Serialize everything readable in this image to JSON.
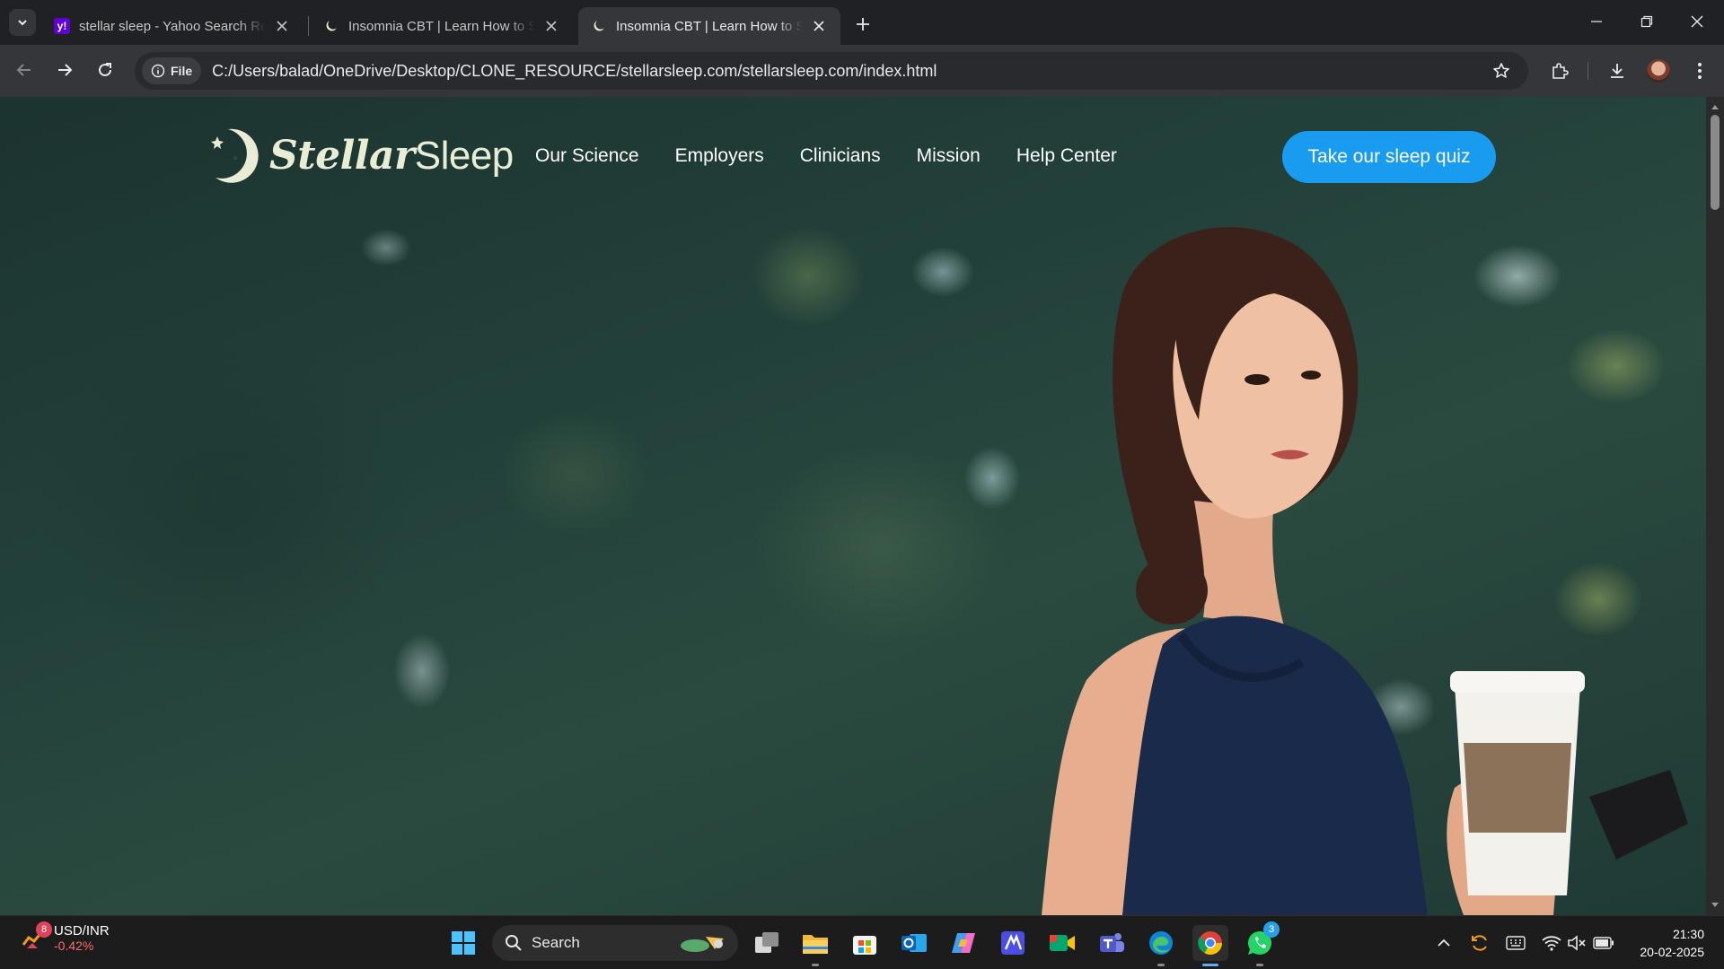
{
  "browser": {
    "tabs": [
      {
        "title": "stellar sleep - Yahoo Search Res",
        "favicon": "yahoo-icon",
        "active": false
      },
      {
        "title": "Insomnia CBT | Learn How to Sleep",
        "favicon": "moon-icon",
        "active": false
      },
      {
        "title": "Insomnia CBT | Learn How to Sleep",
        "favicon": "moon-icon",
        "active": true
      }
    ],
    "address": {
      "scheme_label": "File",
      "url": "C:/Users/balad/OneDrive/Desktop/CLONE_RESOURCE/stellarsleep.com/stellarsleep.com/index.html"
    }
  },
  "site": {
    "logo": {
      "part1": "Stellar",
      "part2": "Sleep"
    },
    "nav": [
      "Our Science",
      "Employers",
      "Clinicians",
      "Mission",
      "Help Center"
    ],
    "cta": "Take our sleep quiz",
    "colors": {
      "cta": "#199cf0",
      "logo": "#e9edd6"
    }
  },
  "taskbar": {
    "widget": {
      "badge": "8",
      "label": "USD/INR",
      "change": "-0.42%"
    },
    "search_label": "Search",
    "whatsapp_badge": "3",
    "clock": {
      "time": "21:30",
      "date": "20-02-2025"
    }
  }
}
